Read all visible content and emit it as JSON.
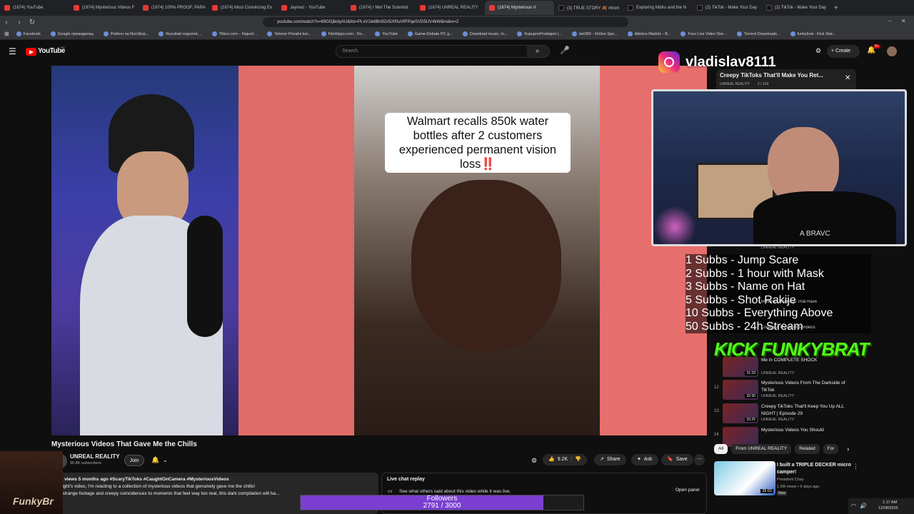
{
  "browser": {
    "tabs": [
      {
        "label": "(1674) YouTube",
        "icon": "youtube-icon"
      },
      {
        "label": "(1674) Mysterious Videos F",
        "icon": "youtube-icon"
      },
      {
        "label": "(1674) 100% PROOF, PARA",
        "icon": "youtube-icon"
      },
      {
        "label": "(1674) Most Convincing Ex",
        "icon": "youtube-icon"
      },
      {
        "label": "Jaymez - YouTube",
        "icon": "youtube-icon"
      },
      {
        "label": "(1674) I Met The Scientist",
        "icon": "youtube-icon"
      },
      {
        "label": "(1674) UNREAL REALITY",
        "icon": "youtube-icon"
      },
      {
        "label": "(1674) Mysterious V",
        "icon": "youtube-icon",
        "active": true
      },
      {
        "label": "(3) TRUE STORY 🍂 #trom",
        "icon": "tiktok-icon"
      },
      {
        "label": "Exploring Nibiru and the N",
        "icon": "tiktok-icon"
      },
      {
        "label": "(2) TikTok - Make Your Day",
        "icon": "tiktok-icon"
      },
      {
        "label": "(2) TikTok - Make Your Day",
        "icon": "tiktok-icon"
      }
    ],
    "url": "youtube.com/watch?v=69GGjbolyAU&list=PLvV1le6Bn92x5iXf0uVtPPqeSVD5UV4kW&index=2",
    "bookmarks": [
      "Facebook",
      "Google преводилац",
      "Poklonı na NonStop...",
      "Rezultati nogomet,...",
      "Titlovi.com – Največ...",
      "Telenor Privatni kor...",
      "FileHippo.com - Do...",
      "YouTube",
      "Game-Debate PC g...",
      "Download music, m...",
      "KupujemProdajem |...",
      "bet365 - Online Spo...",
      "Atletico Madrid – B...",
      "Free Live Video Stre...",
      "Torrent Downloads...",
      "funkybrat - Kick Stat..."
    ]
  },
  "youtube": {
    "logo": "YouTube",
    "logo_sup": "RS",
    "search_placeholder": "Search",
    "create_label": "Create",
    "notif_count": "9+"
  },
  "video": {
    "caption": "Walmart recalls 850k water bottles after 2 customers experienced permanent vision loss‼️",
    "title": "Mysterious Videos That Gave Me the Chills",
    "channel": "UNREAL REALITY",
    "subscribers": "90.8K subscribers",
    "join": "Join",
    "likes": "9.2K",
    "share": "Share",
    "ask": "Ask",
    "save": "Save",
    "desc_meta": "3K views  5 months ago  #ScaryTikToks #CaughtOnCamera #MysteriousVideos",
    "desc_line1": "onight's video, I'm reacting to a collection of mysterious videos that genuinely gave me the chills!",
    "desc_line2": "m strange footage and creepy coincidences to moments that feel way too real, this dark compilation will ha..."
  },
  "live_chat": {
    "title": "Live chat replay",
    "subtitle": "See what others said about this video while it was live.",
    "open_panel": "Open panel"
  },
  "overlay": {
    "ig_handle": "vladislav8111",
    "rewards": [
      "1 Subbs - Jump Scare",
      "2 Subbs - 1 hour with Mask",
      "3 Subbs - Name on Hat",
      "5 Subbs - Shot Rakije",
      "10 Subbs - Everything Above",
      "50 Subbs - 24h Stream"
    ],
    "kick": "KICK FUNKYBRAT",
    "followers_label": "Followers",
    "followers_count": "2791 / 3000",
    "followers_progress": 0.93,
    "streamer_tag": "FunkyBr",
    "shirt_text": "A BRAVC"
  },
  "playlist": {
    "title": "Creepy TikToks That'll Make You Ret...",
    "channel": "UNREAL REALITY",
    "progress": "2 / 134",
    "items": [
      {
        "num": "",
        "title": "Mysterious Videos That Have",
        "channel": "UNREAL REALITY",
        "dur": ""
      },
      {
        "num": "",
        "title": "Creepy & Mysterious Videos",
        "channel": "UNREAL REALITY",
        "dur": ""
      },
      {
        "num": "",
        "title": "Me in COMPLETE SHOCK",
        "channel": "UNREAL REALITY",
        "dur": "31:29"
      },
      {
        "num": "12",
        "title": "Mysterious Videos From The Darkside of TikTok",
        "channel": "UNREAL REALITY",
        "dur": "32:30"
      },
      {
        "num": "13",
        "title": "Creepy TikToks That'll Keep You Up ALL NIGHT | Episode 29",
        "channel": "UNREAL REALITY",
        "dur": "33:25"
      },
      {
        "num": "14",
        "title": "Mysterious Videos You Should",
        "channel": "",
        "dur": ""
      }
    ],
    "chips": [
      "All",
      "From UNREAL REALITY",
      "Related",
      "For"
    ]
  },
  "recommended": {
    "title": "I built a TRIPLE DECKER micro camper!",
    "channel": "President Chay",
    "stats": "1.6M views • 6 days ago",
    "badge": "New",
    "duration": "39:02"
  },
  "system": {
    "time": "1:17 AM",
    "date": "12/08/2025"
  },
  "colors": {
    "yt_red": "#ff0000",
    "followers_bar": "#7a3fd1",
    "kick_green": "#53fc18"
  }
}
